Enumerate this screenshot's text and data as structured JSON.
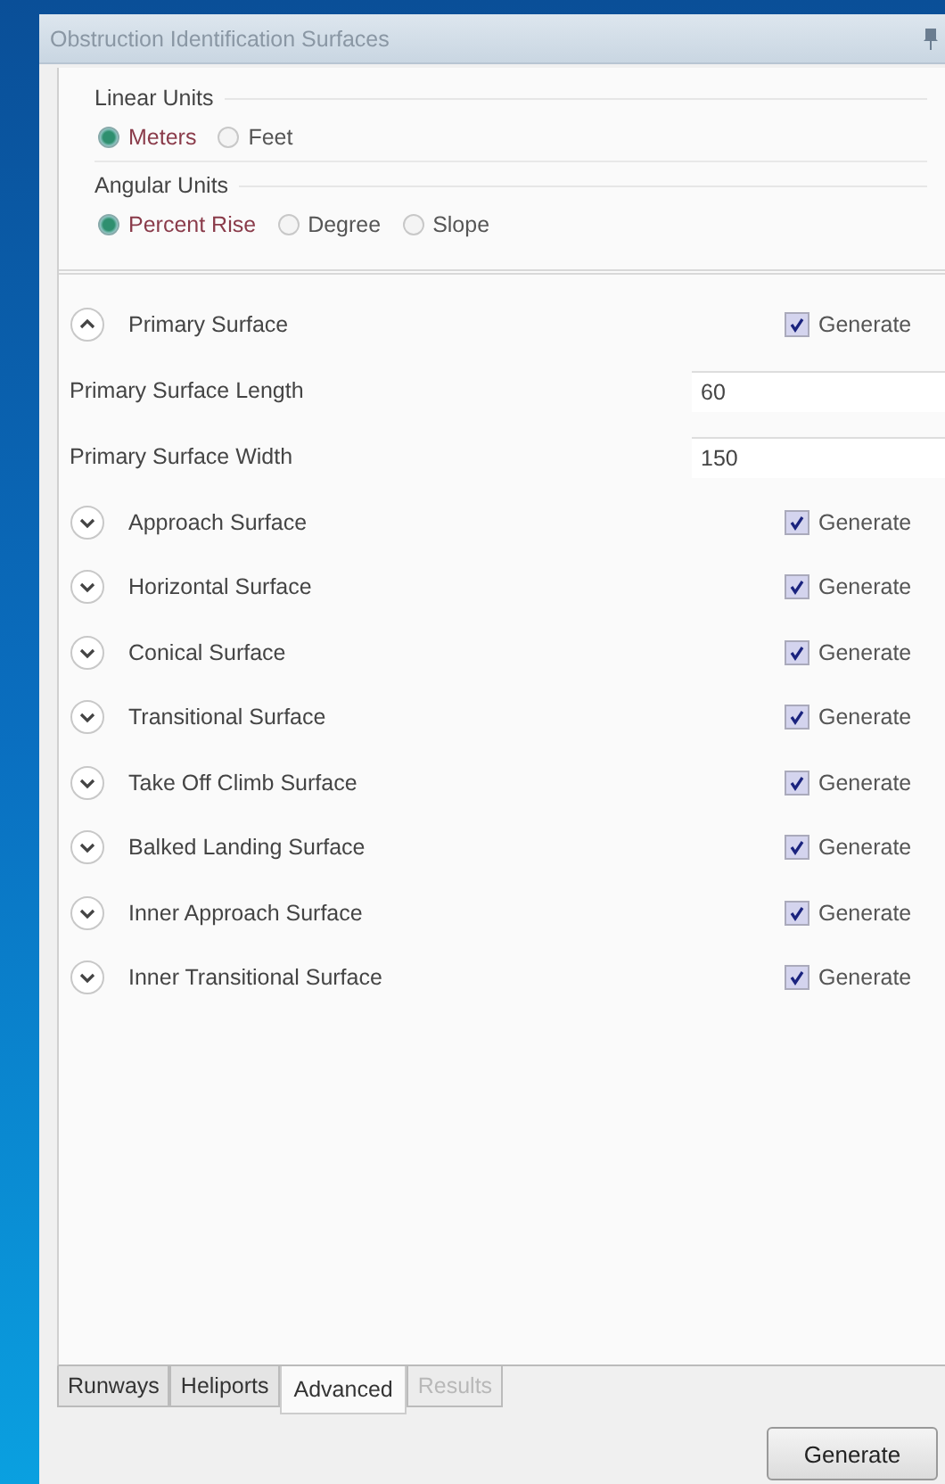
{
  "window": {
    "title": "Obstruction Identification Surfaces"
  },
  "linear_units": {
    "label": "Linear Units",
    "options": [
      {
        "label": "Meters",
        "selected": true
      },
      {
        "label": "Feet",
        "selected": false
      }
    ]
  },
  "angular_units": {
    "label": "Angular Units",
    "options": [
      {
        "label": "Percent Rise",
        "selected": true
      },
      {
        "label": "Degree",
        "selected": false
      },
      {
        "label": "Slope",
        "selected": false
      }
    ]
  },
  "surfaces": [
    {
      "name": "Primary Surface",
      "expanded": true,
      "generate": {
        "label": "Generate",
        "checked": true
      },
      "fields": [
        {
          "label": "Primary Surface Length",
          "value": "60"
        },
        {
          "label": "Primary Surface Width",
          "value": "150"
        }
      ]
    },
    {
      "name": "Approach Surface",
      "expanded": false,
      "generate": {
        "label": "Generate",
        "checked": true
      }
    },
    {
      "name": "Horizontal Surface",
      "expanded": false,
      "generate": {
        "label": "Generate",
        "checked": true
      }
    },
    {
      "name": "Conical Surface",
      "expanded": false,
      "generate": {
        "label": "Generate",
        "checked": true
      }
    },
    {
      "name": "Transitional Surface",
      "expanded": false,
      "generate": {
        "label": "Generate",
        "checked": true
      }
    },
    {
      "name": "Take Off Climb Surface",
      "expanded": false,
      "generate": {
        "label": "Generate",
        "checked": true
      }
    },
    {
      "name": "Balked Landing Surface",
      "expanded": false,
      "generate": {
        "label": "Generate",
        "checked": true
      }
    },
    {
      "name": "Inner Approach Surface",
      "expanded": false,
      "generate": {
        "label": "Generate",
        "checked": true
      }
    },
    {
      "name": "Inner Transitional Surface",
      "expanded": false,
      "generate": {
        "label": "Generate",
        "checked": true
      }
    }
  ],
  "tabs": [
    {
      "label": "Runways",
      "selected": false,
      "disabled": false
    },
    {
      "label": "Heliports",
      "selected": false,
      "disabled": false
    },
    {
      "label": "Advanced",
      "selected": true,
      "disabled": false
    },
    {
      "label": "Results",
      "selected": false,
      "disabled": true
    }
  ],
  "button": "Generate"
}
